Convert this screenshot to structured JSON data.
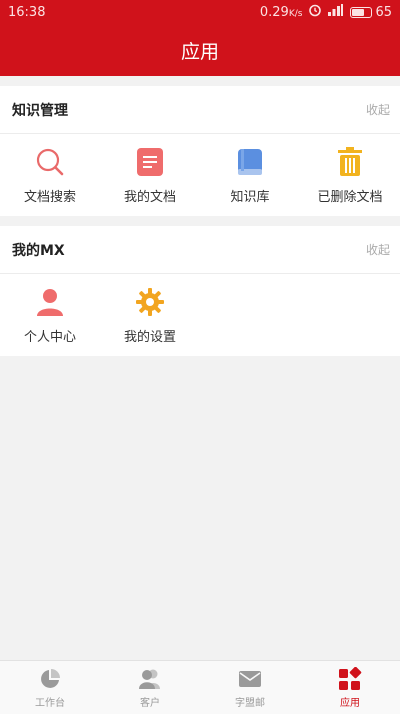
{
  "status": {
    "time": "16:38",
    "speed": "0.29",
    "speed_unit": "K/s",
    "battery": "65"
  },
  "header": {
    "title": "应用"
  },
  "sections": [
    {
      "title": "知识管理",
      "action": "收起",
      "items": [
        {
          "label": "文档搜索",
          "icon": "search-icon",
          "color": "#e96a6a"
        },
        {
          "label": "我的文档",
          "icon": "document-icon",
          "color": "#ef6c6c"
        },
        {
          "label": "知识库",
          "icon": "book-icon",
          "color": "#5b8fe0"
        },
        {
          "label": "已删除文档",
          "icon": "trash-icon",
          "color": "#f2b31f"
        }
      ]
    },
    {
      "title": "我的MX",
      "action": "收起",
      "items": [
        {
          "label": "个人中心",
          "icon": "person-icon",
          "color": "#ef6c6c"
        },
        {
          "label": "我的设置",
          "icon": "gear-icon",
          "color": "#f2a51f"
        }
      ]
    }
  ],
  "tabbar": {
    "items": [
      {
        "label": "工作台",
        "icon": "pie-chart-icon",
        "active": false
      },
      {
        "label": "客户",
        "icon": "contacts-icon",
        "active": false
      },
      {
        "label": "字盟邮",
        "icon": "mail-icon",
        "active": false
      },
      {
        "label": "应用",
        "icon": "apps-icon",
        "active": true
      }
    ],
    "active_color": "#d0121b",
    "inactive_color": "#9a9a9a"
  },
  "colors": {
    "brand": "#d0121b",
    "background": "#f2f2f2"
  }
}
